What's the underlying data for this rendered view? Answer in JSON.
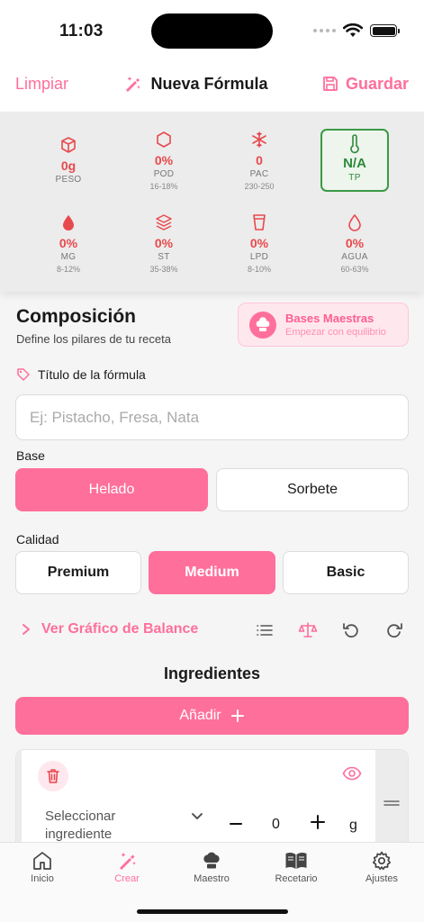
{
  "status": {
    "time": "11:03"
  },
  "header": {
    "clear_label": "Limpiar",
    "title": "Nueva Fórmula",
    "save_label": "Guardar"
  },
  "metrics": [
    {
      "icon": "cube-icon",
      "value": "0g",
      "label": "PESO",
      "range": ""
    },
    {
      "icon": "hexagon-icon",
      "value": "0%",
      "label": "POD",
      "range": "16-18%"
    },
    {
      "icon": "snowflake-icon",
      "value": "0",
      "label": "PAC",
      "range": "230-250"
    },
    {
      "icon": "thermometer-icon",
      "value": "N/A",
      "label": "TP",
      "range": ""
    },
    {
      "icon": "drop-icon",
      "value": "0%",
      "label": "MG",
      "range": "8-12%"
    },
    {
      "icon": "layers-icon",
      "value": "0%",
      "label": "ST",
      "range": "35-38%"
    },
    {
      "icon": "glass-icon",
      "value": "0%",
      "label": "LPD",
      "range": "8-10%"
    },
    {
      "icon": "water-drop-icon",
      "value": "0%",
      "label": "AGUA",
      "range": "60-63%"
    }
  ],
  "composition": {
    "title": "Composición",
    "subtitle": "Define los pilares de tu receta",
    "bases_title": "Bases Maestras",
    "bases_subtitle": "Empezar con equilibrio"
  },
  "formula": {
    "title_label": "Título de la fórmula",
    "title_placeholder": "Ej: Pistacho, Fresa, Nata"
  },
  "base": {
    "label": "Base",
    "options": [
      "Helado",
      "Sorbete"
    ],
    "selected": "Helado"
  },
  "quality": {
    "label": "Calidad",
    "options": [
      "Premium",
      "Medium",
      "Basic"
    ],
    "selected": "Medium"
  },
  "balance_label": "Ver Gráfico de Balance",
  "ingredients": {
    "title": "Ingredientes",
    "add_label": "Añadir",
    "row": {
      "select_label": "Seleccionar ingrediente",
      "quantity": "0",
      "unit": "g"
    }
  },
  "tabs": [
    {
      "label": "Inicio",
      "icon": "home-icon"
    },
    {
      "label": "Crear",
      "icon": "pencil-magic-icon"
    },
    {
      "label": "Maestro",
      "icon": "chef-hat-icon"
    },
    {
      "label": "Recetario",
      "icon": "book-icon"
    },
    {
      "label": "Ajustes",
      "icon": "gear-icon"
    }
  ],
  "colors": {
    "accent": "#ff6f9c",
    "danger": "#e8494d",
    "success": "#2f8a3b"
  }
}
